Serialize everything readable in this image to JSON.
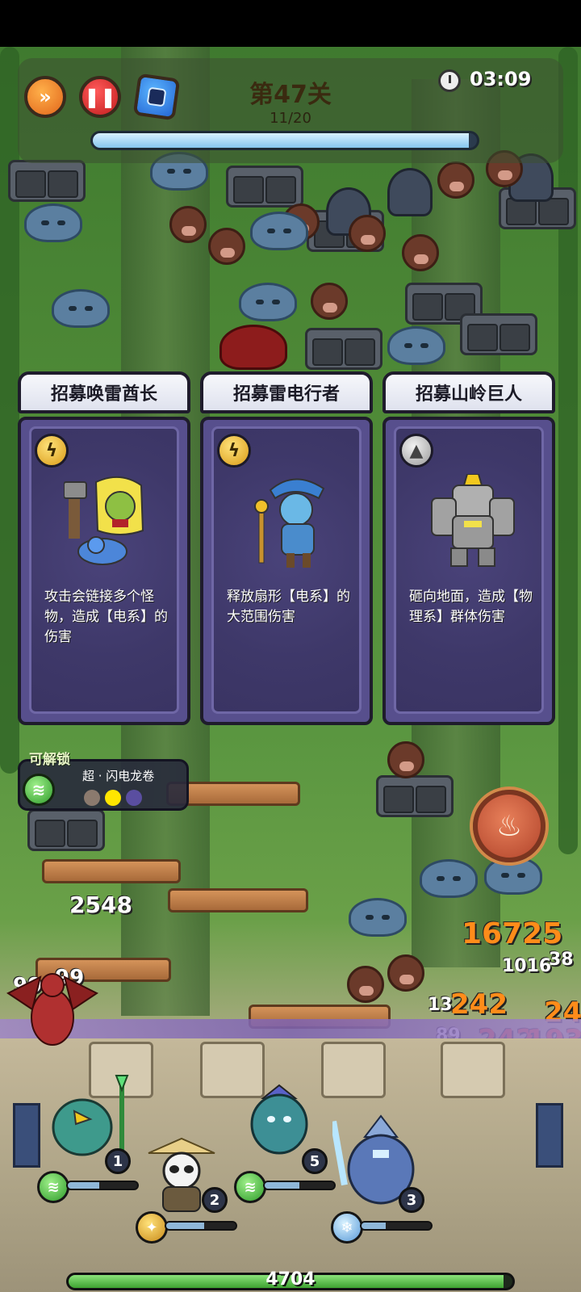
{
  "hud": {
    "level_title": "第47关",
    "wave_count": "11/20",
    "wave_progress": 0.98,
    "timer": "03:09",
    "buttons": {
      "fast_forward_icon": "fast-forward-icon",
      "pause_icon": "pause-icon",
      "skill_icon": "skill-card-icon"
    }
  },
  "recruit_cards": [
    {
      "title": "招募唤雷酋长",
      "element_icon": "lightning-element-icon",
      "element": "electric",
      "description": "攻击会链接多个怪物，造成【电系】的伤害"
    },
    {
      "title": "招募雷电行者",
      "element_icon": "lightning-element-icon",
      "element": "electric",
      "description": "释放扇形【电系】的大范围伤害"
    },
    {
      "title": "招募山岭巨人",
      "element_icon": "rock-element-icon",
      "element": "physical",
      "description": "砸向地面，造成【物理系】群体伤害"
    }
  ],
  "unlock": {
    "label": "可解锁",
    "skill_name": "超 · 闪电龙卷",
    "icon": "tornado-icon",
    "dots": [
      "#8b7a6e",
      "#ffe600",
      "#5a4ea0"
    ]
  },
  "damage_numbers": {
    "left_2548": "2548",
    "left_99a": "99",
    "left_99b": "99",
    "big_16725": "16725",
    "n_1016": "1016",
    "n_38": "38",
    "n_242a": "242",
    "n_24": "24",
    "n_13": "13",
    "n_242b": "242",
    "n_193": "193",
    "n_89": "89"
  },
  "units": [
    {
      "level": "1",
      "element_icon": "tornado-icon",
      "hp_fraction": 0.45
    },
    {
      "level": "2",
      "element_icon": "earth-crack-icon",
      "hp_fraction": 0.55
    },
    {
      "level": "5",
      "element_icon": "tornado-icon",
      "hp_fraction": 0.5
    },
    {
      "level": "3",
      "element_icon": "ice-crystal-icon",
      "hp_fraction": 0.35
    }
  ],
  "base_hp": {
    "value": "4704",
    "fraction": 0.98
  },
  "colors": {
    "card_purple": "#574f8d",
    "electric": "#f0c02a",
    "physical": "#b0b0b0",
    "damage_orange": "#ff8c1a",
    "damage_red": "#e23b1b"
  }
}
